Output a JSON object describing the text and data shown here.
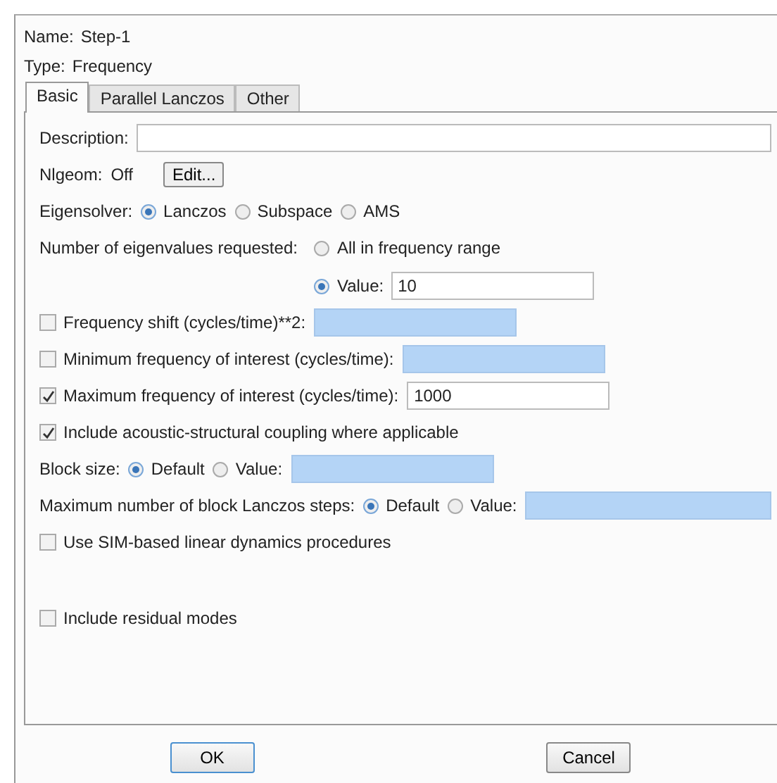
{
  "header": [
    {
      "label": "Name:",
      "value": "Step-1"
    },
    {
      "label": "Type:",
      "value": "Frequency"
    }
  ],
  "tabs": [
    {
      "label": "Basic",
      "selected": true
    },
    {
      "label": "Parallel Lanczos",
      "selected": false
    },
    {
      "label": "Other",
      "selected": false
    }
  ],
  "rows": [
    {
      "kind": "wide",
      "items": [
        {
          "kind": "text",
          "text": "Description:"
        },
        {
          "kind": "field",
          "disabled": false
        }
      ]
    },
    {
      "kind": "plain",
      "items": [
        {
          "kind": "text",
          "text": "Nlgeom:"
        },
        {
          "kind": "text",
          "text": "Off"
        },
        {
          "kind": "button",
          "label": "Edit..."
        }
      ]
    },
    {
      "kind": "plain",
      "items": [
        {
          "kind": "text",
          "text": "Eigensolver:"
        },
        {
          "kind": "radio",
          "label": "Lanczos",
          "selected": true
        },
        {
          "kind": "radio",
          "label": "Subspace",
          "selected": false
        },
        {
          "kind": "radio",
          "label": "AMS",
          "selected": false
        }
      ]
    },
    {
      "kind": "stack",
      "label": "Number of eigenvalues requested:",
      "items": [
        {
          "kind": "radio",
          "label": "All in frequency range",
          "selected": false
        },
        {
          "kind": "radio",
          "label": "Value:",
          "selected": true,
          "field": {
            "value": "10",
            "disabled": false
          }
        }
      ]
    },
    {
      "kind": "plain",
      "items": [
        {
          "kind": "checkbox",
          "label": "Frequency shift (cycles/time)**2:",
          "checked": false
        },
        {
          "kind": "field",
          "disabled": true
        }
      ]
    },
    {
      "kind": "plain",
      "items": [
        {
          "kind": "checkbox",
          "label": "Minimum frequency of interest (cycles/time):",
          "checked": false
        },
        {
          "kind": "field",
          "disabled": true
        }
      ]
    },
    {
      "kind": "plain",
      "items": [
        {
          "kind": "checkbox",
          "label": "Maximum frequency of interest (cycles/time):",
          "checked": true
        },
        {
          "kind": "field",
          "value": "1000",
          "disabled": false
        }
      ]
    },
    {
      "kind": "plain",
      "items": [
        {
          "kind": "checkbox",
          "label": "Include acoustic-structural coupling where applicable",
          "checked": true
        }
      ]
    },
    {
      "kind": "plain",
      "items": [
        {
          "kind": "text",
          "text": "Block size:"
        },
        {
          "kind": "radio",
          "label": "Default",
          "selected": true
        },
        {
          "kind": "radio",
          "label": "Value:",
          "selected": false
        },
        {
          "kind": "field",
          "disabled": true
        }
      ]
    },
    {
      "kind": "wide",
      "items": [
        {
          "kind": "text",
          "text": "Maximum number of block Lanczos steps:"
        },
        {
          "kind": "radio",
          "label": "Default",
          "selected": true
        },
        {
          "kind": "radio",
          "label": "Value:",
          "selected": false
        },
        {
          "kind": "field",
          "disabled": true
        }
      ]
    },
    {
      "kind": "plain",
      "items": [
        {
          "kind": "checkbox",
          "label": "Use SIM-based linear dynamics procedures",
          "checked": false
        }
      ]
    },
    {
      "kind": "section",
      "items": [
        {
          "kind": "checkbox",
          "label": "Include residual modes",
          "checked": false
        }
      ]
    }
  ],
  "buttons": [
    {
      "label": "OK",
      "default": true
    },
    {
      "label": "Cancel",
      "default": false
    }
  ]
}
